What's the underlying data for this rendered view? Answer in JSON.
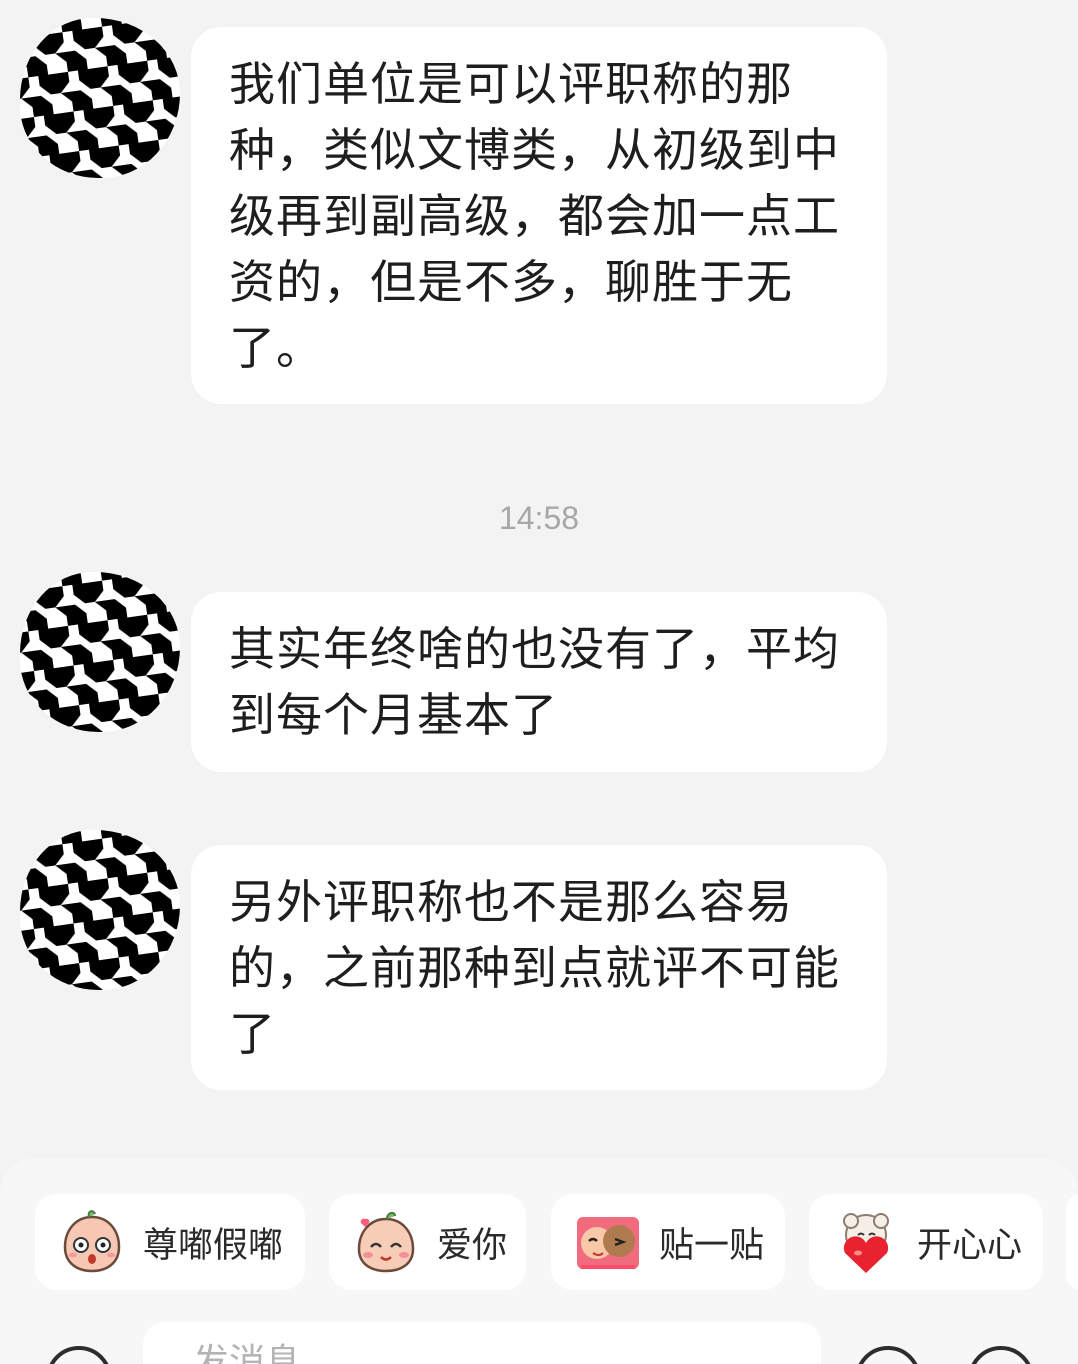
{
  "messages": [
    {
      "text": "我们单位是可以评职称的那\n种，类似文博类，从初级到中\n级再到副高级，都会加一点工\n资的，但是不多，聊胜于无\n了。"
    },
    {
      "text": "其实年终啥的也没有了，平均\n到每个月基本了"
    },
    {
      "text": "另外评职称也不是那么容易\n的，之前那种到点就评不可能\n了"
    }
  ],
  "timestamp": "14:58",
  "quick_stickers": [
    {
      "label": "尊嘟假嘟",
      "icon": "surprised-peach-icon"
    },
    {
      "label": "爱你",
      "icon": "love-peach-icon"
    },
    {
      "label": "贴一贴",
      "icon": "hug-icon"
    },
    {
      "label": "开心心",
      "icon": "heart-sheep-icon"
    }
  ],
  "composer": {
    "placeholder": "发消息",
    "left_icon": "voice-icon",
    "right_icons": [
      "emoji-icon",
      "plus-icon"
    ]
  },
  "colors": {
    "background": "#f3f3f3",
    "bubble": "#ffffff",
    "text": "#1e1e1e",
    "timestamp": "#a7a7a7"
  }
}
